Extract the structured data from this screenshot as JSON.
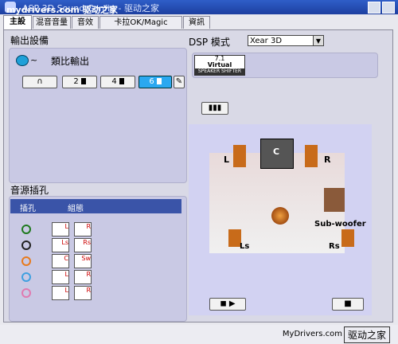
{
  "window": {
    "title": "ASP 3D Sound Config - 驱动之家",
    "watermark_top": "mydrivers.com 驱动之家"
  },
  "tabs": [
    {
      "label": "主設定",
      "active": true
    },
    {
      "label": "混音音量"
    },
    {
      "label": "音效"
    },
    {
      "label": "卡拉OK/Magic Voice"
    },
    {
      "label": "資訊"
    }
  ],
  "output_section": {
    "title": "輸出設備",
    "analog_label": "類比輸出",
    "buttons": [
      {
        "label": "",
        "icon": "headphone-icon"
      },
      {
        "label": "2",
        "icon": "speaker-icon"
      },
      {
        "label": "4",
        "icon": "speaker-icon"
      },
      {
        "label": "6",
        "icon": "speaker-icon",
        "selected": true
      },
      {
        "label": "",
        "icon": "wrench-icon"
      }
    ]
  },
  "jack_section": {
    "title": "音源插孔",
    "col_jack": "插孔",
    "col_config": "組態",
    "rows": [
      {
        "jack_color": "#1f7a1f",
        "configs": [
          "L",
          "R"
        ]
      },
      {
        "jack_color": "#222222",
        "configs": [
          "Ls",
          "Rs"
        ]
      },
      {
        "jack_color": "#e87a1c",
        "configs": [
          "C",
          "Sw"
        ]
      },
      {
        "jack_color": "#3fa0e0",
        "configs": [
          "L",
          "R"
        ]
      },
      {
        "jack_color": "#e07ab0",
        "configs": [
          "L",
          "R"
        ]
      }
    ]
  },
  "dsp": {
    "label": "DSP 模式",
    "mode": "Xear 3D",
    "badge_top": "7.1",
    "badge_mid": "Virtual",
    "badge_bottom": "SPEAKER SHIFTER"
  },
  "speakers": {
    "L": "L",
    "C": "C",
    "R": "R",
    "Subwoofer": "Sub-woofer",
    "Ls": "Ls",
    "Rs": "Rs"
  },
  "status": {
    "watermark": "MyDrivers.com",
    "watermark2": "驱动之家"
  }
}
